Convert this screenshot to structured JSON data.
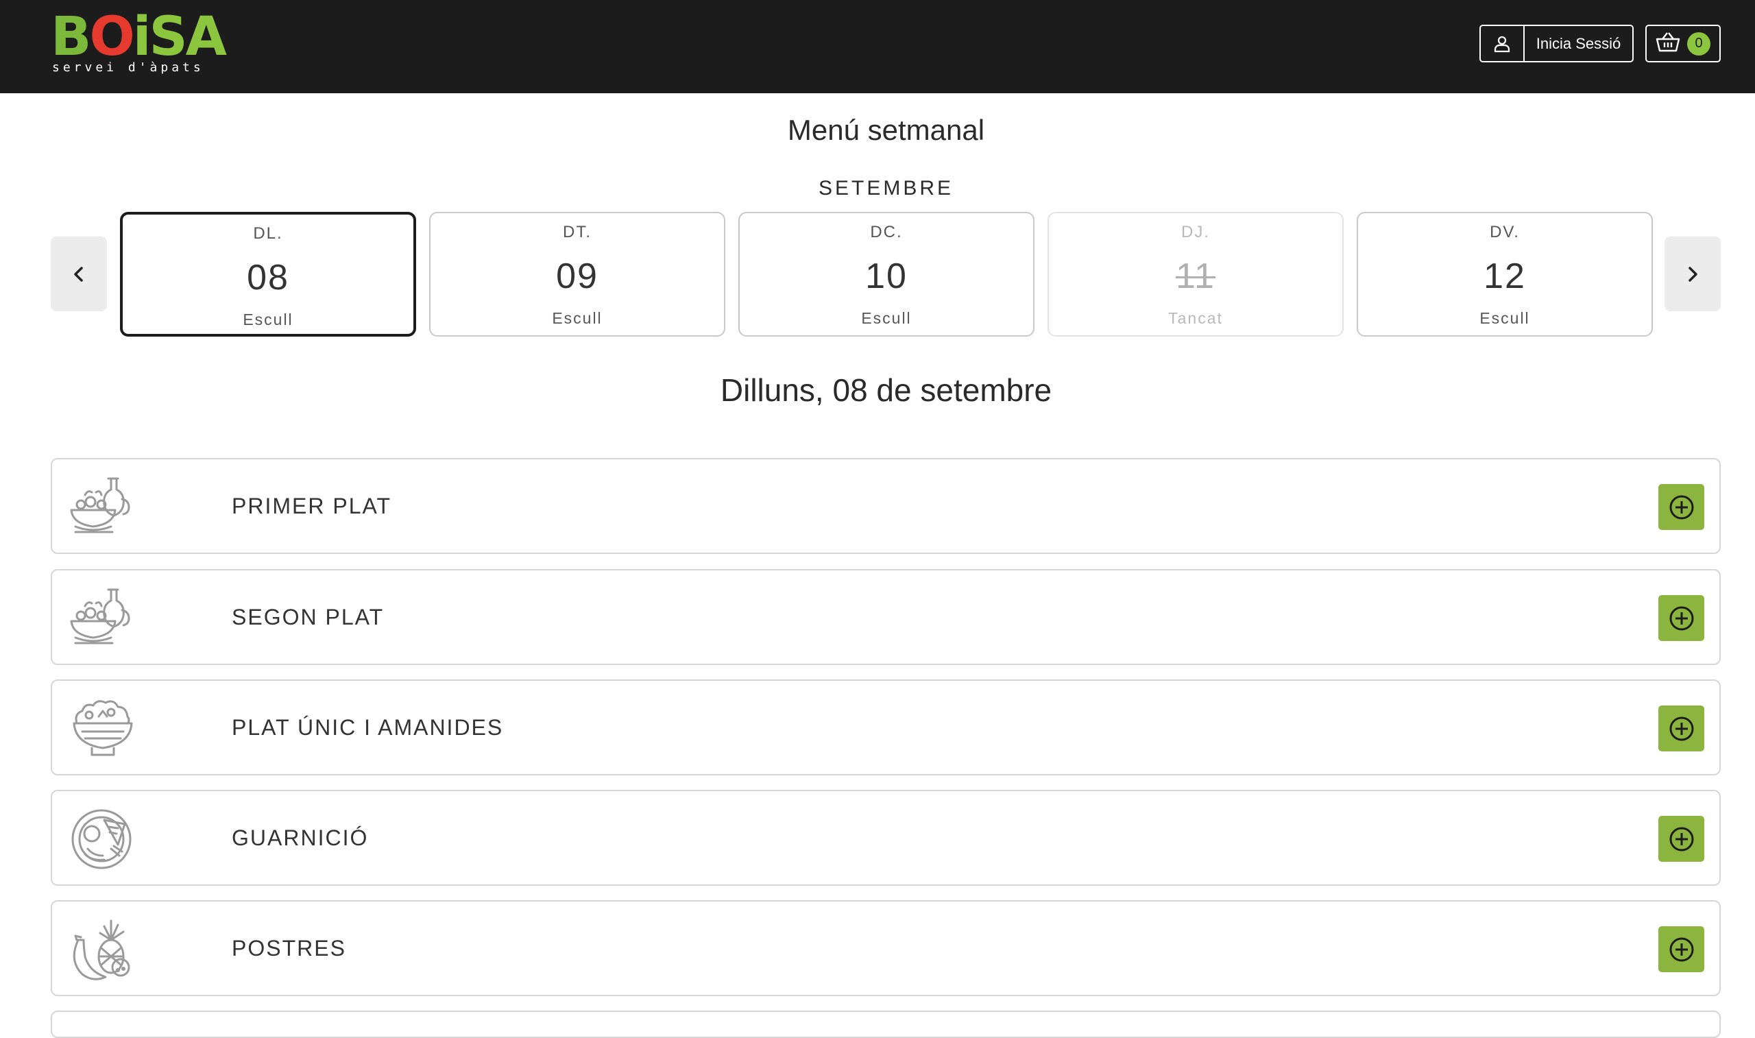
{
  "header": {
    "logo": {
      "text": "BOiSA",
      "subtitle": "servei d'àpats"
    },
    "login_label": "Inicia Sessió",
    "cart_count": "0",
    "colors": {
      "background": "#1c1c1c",
      "accent": "#8cc63f",
      "logo_red": "#e63a2e"
    }
  },
  "page": {
    "title": "Menú setmanal",
    "month": "SETEMBRE",
    "date_heading": "Dilluns, 08 de setembre"
  },
  "days": [
    {
      "abbr": "DL.",
      "num": "08",
      "status": "Escull",
      "selected": true
    },
    {
      "abbr": "DT.",
      "num": "09",
      "status": "Escull"
    },
    {
      "abbr": "DC.",
      "num": "10",
      "status": "Escull"
    },
    {
      "abbr": "DJ.",
      "num": "11",
      "status": "Tancat",
      "closed": true
    },
    {
      "abbr": "DV.",
      "num": "12",
      "status": "Escull"
    }
  ],
  "categories": [
    {
      "label": "PRIMER PLAT",
      "icon": "soup-bowl-icon"
    },
    {
      "label": "SEGON PLAT",
      "icon": "soup-bowl-icon"
    },
    {
      "label": "PLAT ÚNIC I AMANIDES",
      "icon": "salad-bowl-icon"
    },
    {
      "label": "GUARNICIÓ",
      "icon": "side-dish-icon"
    },
    {
      "label": "POSTRES",
      "icon": "fruit-icon"
    }
  ]
}
